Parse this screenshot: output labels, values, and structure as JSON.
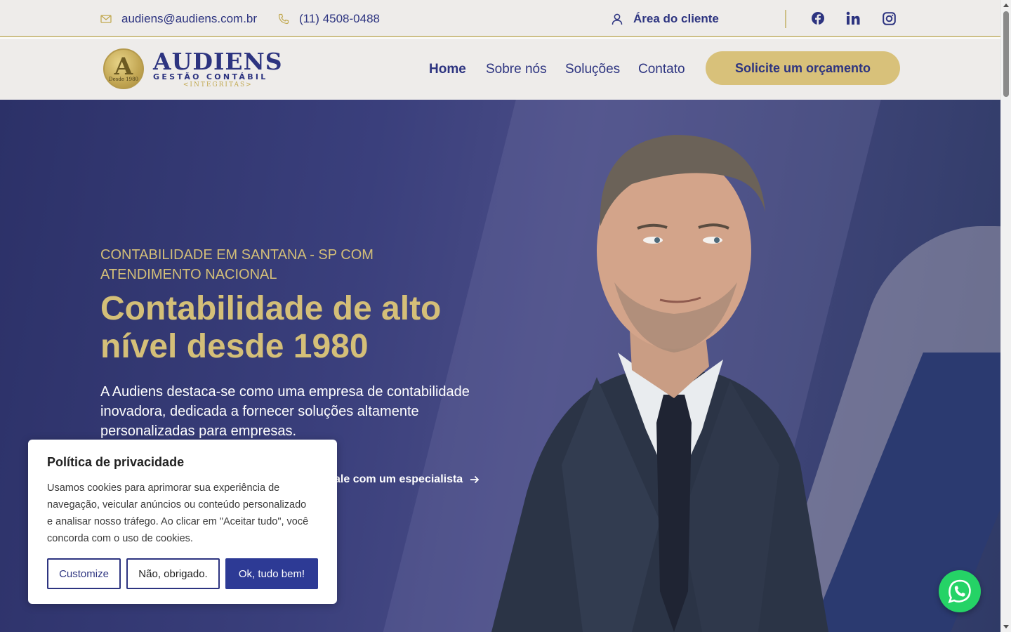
{
  "topbar": {
    "email": "audiens@audiens.com.br",
    "phone": "(11) 4508-0488",
    "client_area": "Área do cliente",
    "socials": [
      "facebook-icon",
      "linkedin-icon",
      "instagram-icon"
    ]
  },
  "logo": {
    "brand": "AUDIENS",
    "subtitle": "GESTÃO CONTÁBIL",
    "tagline": "<INTEGRITAS>",
    "mark_letter": "A",
    "mark_since": "Desde 1980"
  },
  "nav": {
    "items": [
      {
        "label": "Home",
        "active": true
      },
      {
        "label": "Sobre nós",
        "active": false
      },
      {
        "label": "Soluções",
        "active": false
      },
      {
        "label": "Contato",
        "active": false
      }
    ],
    "cta": "Solicite um orçamento"
  },
  "hero": {
    "eyebrow": "CONTABILIDADE EM SANTANA - SP COM ATENDIMENTO NACIONAL",
    "headline": "Contabilidade de alto nível desde 1980",
    "lead": "A Audiens destaca-se como uma empresa de contabilidade inovadora, dedicada a fornecer soluções altamente personalizadas para empresas.",
    "specialist_link": "ale com um especialista"
  },
  "cookie": {
    "title": "Política de privacidade",
    "text": "Usamos cookies para aprimorar sua experiência de navegação, veicular anúncios ou conteúdo personalizado e analisar nosso tráfego. Ao clicar em \"Aceitar tudo\", você concorda com o uso de cookies.",
    "customize": "Customize",
    "decline": "Não, obrigado.",
    "accept": "Ok, tudo bem!"
  },
  "colors": {
    "navy": "#2d3480",
    "gold": "#d4bf78",
    "topbar_bg": "#eeecea",
    "whatsapp": "#25d366"
  }
}
